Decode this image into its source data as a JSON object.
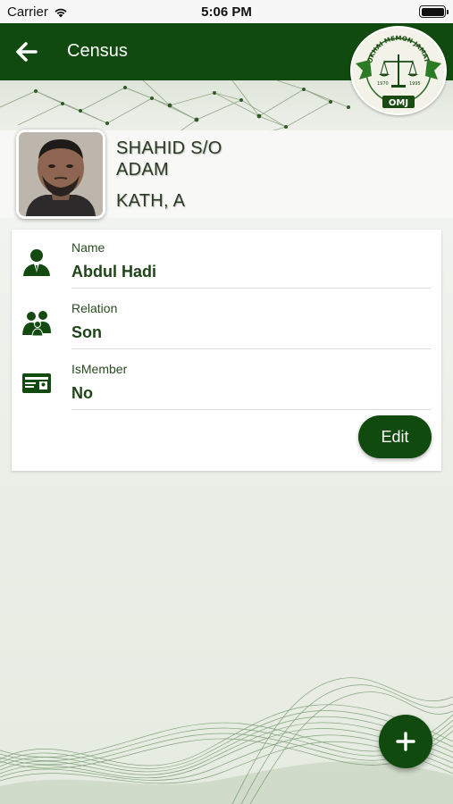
{
  "status_bar": {
    "carrier": "Carrier",
    "time": "5:06 PM"
  },
  "header": {
    "title": "Census",
    "back_icon": "arrow-left-icon"
  },
  "logo": {
    "text_top": "OKHAI MEMON JAMAT",
    "text_badge": "OMJ",
    "year_left": "1970",
    "year_right": "1995"
  },
  "profile": {
    "name_line1": "SHAHID  S/O",
    "name_line2": "ADAM",
    "code": "KATH, A"
  },
  "details": [
    {
      "icon": "person-icon",
      "label": "Name",
      "value": "Abdul Hadi"
    },
    {
      "icon": "family-icon",
      "label": "Relation",
      "value": "Son"
    },
    {
      "icon": "member-card-icon",
      "label": "IsMember",
      "value": "No"
    }
  ],
  "edit_label": "Edit",
  "fab_icon": "plus-icon",
  "colors": {
    "primary": "#104a0e",
    "text_dark": "#1e4418"
  }
}
